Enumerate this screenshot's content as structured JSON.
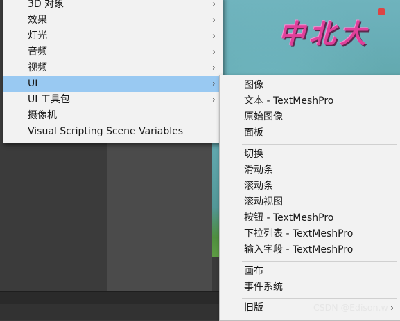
{
  "scene": {
    "title_text": "中北大"
  },
  "main_menu": {
    "items": [
      {
        "label": "3D 对象",
        "has_submenu": true
      },
      {
        "label": "效果",
        "has_submenu": true
      },
      {
        "label": "灯光",
        "has_submenu": true
      },
      {
        "label": "音频",
        "has_submenu": true
      },
      {
        "label": "视频",
        "has_submenu": true
      },
      {
        "label": "UI",
        "has_submenu": true,
        "selected": true
      },
      {
        "label": "UI 工具包",
        "has_submenu": true
      },
      {
        "label": "摄像机",
        "has_submenu": false
      },
      {
        "label": "Visual Scripting Scene Variables",
        "has_submenu": false
      }
    ],
    "arrow_glyph": "›"
  },
  "ui_submenu": {
    "group1": [
      "图像",
      "文本 - TextMeshPro",
      "原始图像",
      "面板"
    ],
    "group2": [
      "切换",
      "滑动条",
      "滚动条",
      "滚动视图",
      "按钮 - TextMeshPro",
      "下拉列表 - TextMeshPro",
      "输入字段 - TextMeshPro"
    ],
    "group3": [
      "画布",
      "事件系统"
    ],
    "group4": [
      {
        "label": "旧版",
        "has_submenu": true
      }
    ]
  },
  "watermark": "CSDN @Edison.w",
  "colors": {
    "selected_bg": "#99c9f2",
    "menu_bg": "#f2f2f2",
    "title_pink": "#e0409a"
  }
}
